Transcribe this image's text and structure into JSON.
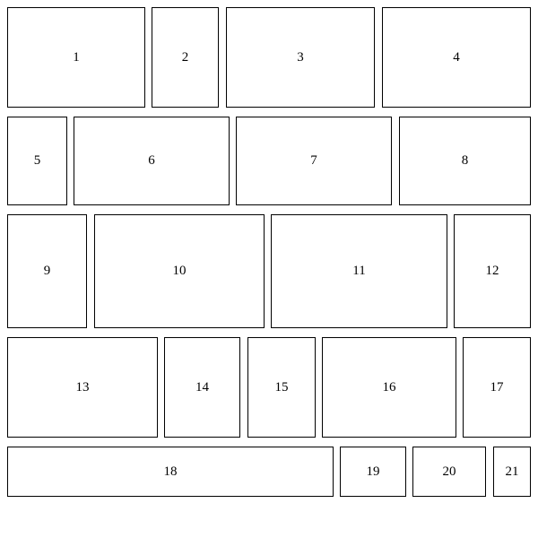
{
  "boxes": [
    {
      "label": "1"
    },
    {
      "label": "2"
    },
    {
      "label": "3"
    },
    {
      "label": "4"
    },
    {
      "label": "5"
    },
    {
      "label": "6"
    },
    {
      "label": "7"
    },
    {
      "label": "8"
    },
    {
      "label": "9"
    },
    {
      "label": "10"
    },
    {
      "label": "11"
    },
    {
      "label": "12"
    },
    {
      "label": "13"
    },
    {
      "label": "14"
    },
    {
      "label": "15"
    },
    {
      "label": "16"
    },
    {
      "label": "17"
    },
    {
      "label": "18"
    },
    {
      "label": "19"
    },
    {
      "label": "20"
    },
    {
      "label": "21"
    }
  ]
}
